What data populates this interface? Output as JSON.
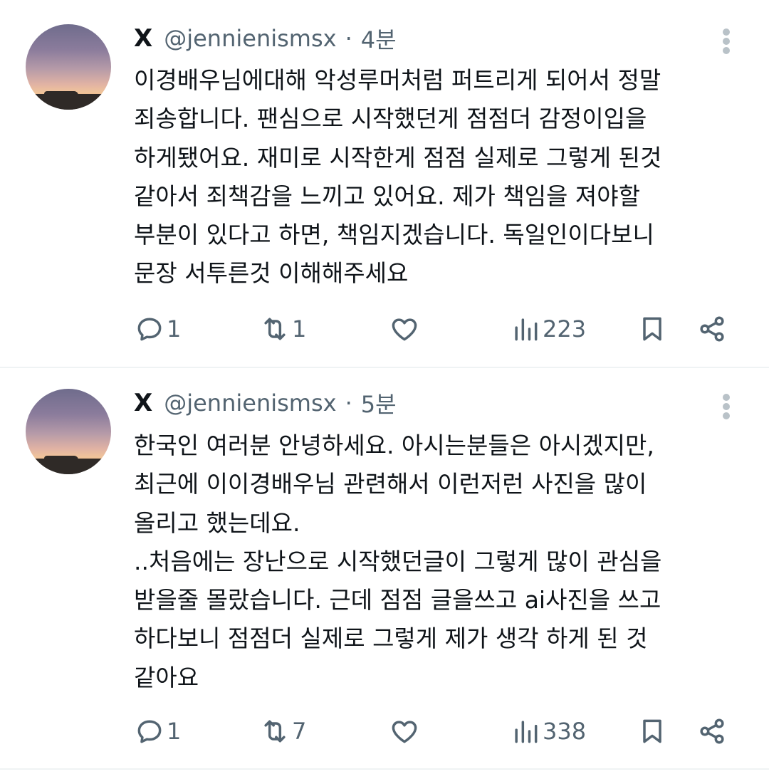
{
  "tweets": [
    {
      "name": "X",
      "handle": "@jennienismsx",
      "separator": "·",
      "time": "4분",
      "lines": [
        "이경배우님에대해 악성루머처럼 퍼트리게 되어서 정말",
        "죄송합니다. 팬심으로 시작했던게 점점더 감정이입을",
        "하게됐어요. 재미로 시작한게 점점 실제로 그렇게 된것",
        "같아서 죄책감을 느끼고 있어요. 제가 책임을 져야할",
        "부분이 있다고 하면, 책임지겠습니다. 독일인이다보니",
        "문장 서투른것 이해해주세요"
      ],
      "replies": "1",
      "reposts": "1",
      "views": "223"
    },
    {
      "name": "X",
      "handle": "@jennienismsx",
      "separator": "·",
      "time": "5분",
      "lines": [
        "한국인 여러분 안녕하세요. 아시는분들은 아시겠지만,",
        "최근에 이이경배우님 관련해서 이런저런 사진을 많이",
        "올리고 했는데요.",
        "..처음에는 장난으로 시작했던글이 그렇게 많이 관심을",
        "받을줄 몰랐습니다. 근데 점점 글을쓰고 ai사진을 쓰고",
        "하다보니 점점더 실제로 그렇게 제가 생각 하게 된 것",
        "같아요"
      ],
      "replies": "1",
      "reposts": "7",
      "views": "338"
    }
  ],
  "icons": {
    "reply": "reply-icon",
    "repost": "repost-icon",
    "like": "heart-icon",
    "views": "views-chart-icon",
    "bookmark": "bookmark-icon",
    "share": "share-icon",
    "more": "more-vertical-icon"
  },
  "colors": {
    "text": "#0f1419",
    "secondary": "#536471",
    "divider": "#eff3f4"
  }
}
